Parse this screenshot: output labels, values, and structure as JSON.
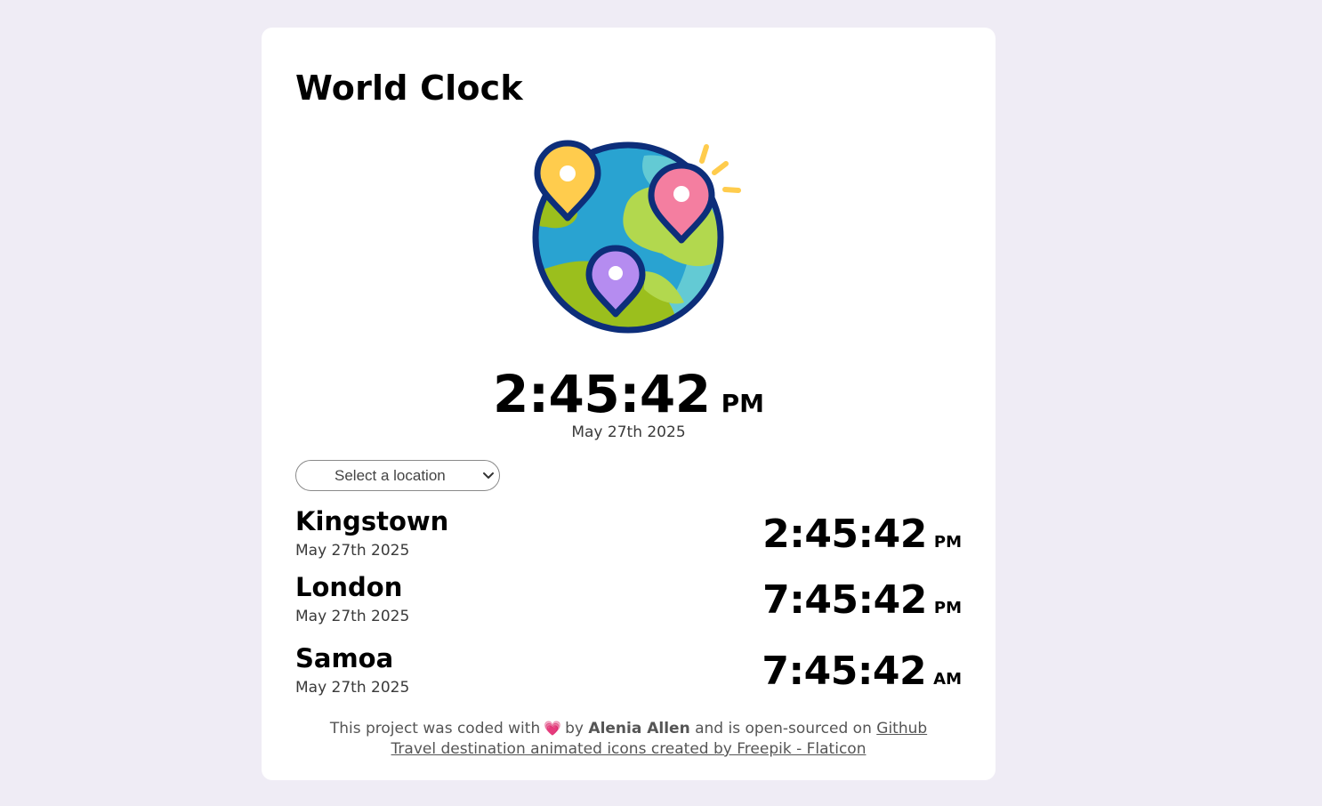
{
  "app": {
    "title": "World Clock"
  },
  "main": {
    "time": "2:45:42",
    "ampm": "PM",
    "date": "May 27th 2025"
  },
  "location_select": {
    "placeholder": "Select a location"
  },
  "cities": [
    {
      "name": "Kingstown",
      "date": "May 27th 2025",
      "time": "2:45:42",
      "ampm": "PM"
    },
    {
      "name": "London",
      "date": "May 27th 2025",
      "time": "7:45:42",
      "ampm": "PM"
    },
    {
      "name": "Samoa",
      "date": "May 27th 2025",
      "time": "7:45:42",
      "ampm": "AM"
    }
  ],
  "footer": {
    "text_before": "This project was coded with",
    "heart": "💗",
    "by": "by",
    "author": "Alenia Allen",
    "text_after": "and is open-sourced on",
    "github_link": "Github",
    "credit_link": "Travel destination animated icons created by Freepik - Flaticon"
  },
  "icons": {
    "globe": "globe-with-location-pins-icon",
    "chevron": "chevron-down-icon",
    "heart": "heart-icon"
  },
  "colors": {
    "background": "#efecf5",
    "card": "#ffffff",
    "globe_ocean": "#29a3d1",
    "globe_land": "#9bbf1d",
    "globe_outline": "#0d2e7a",
    "pin_yellow": "#ffcc4d",
    "pin_pink": "#f47ea0",
    "pin_purple": "#b58cf0"
  }
}
